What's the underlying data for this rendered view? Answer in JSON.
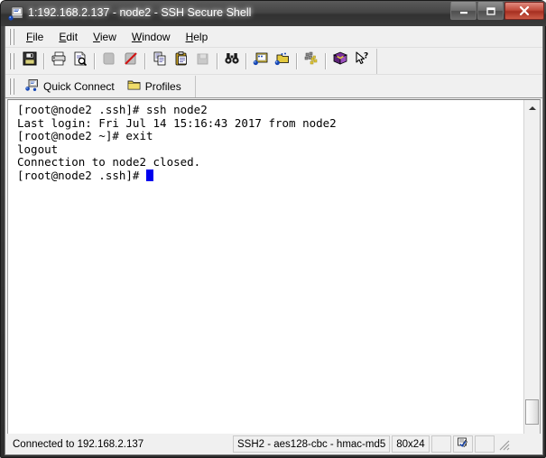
{
  "window": {
    "title": "1:192.168.2.137 - node2 - SSH Secure Shell",
    "app_icon": "ssh-terminal-icon",
    "buttons": {
      "minimize": "minimize-button",
      "maximize": "maximize-button",
      "close": "close-button"
    }
  },
  "menubar": {
    "items": [
      {
        "label": "File",
        "accel": "F"
      },
      {
        "label": "Edit",
        "accel": "E"
      },
      {
        "label": "View",
        "accel": "V"
      },
      {
        "label": "Window",
        "accel": "W"
      },
      {
        "label": "Help",
        "accel": "H"
      }
    ]
  },
  "toolbar": {
    "buttons": [
      {
        "name": "save-icon",
        "enabled": true
      },
      {
        "name": "print-icon",
        "enabled": true
      },
      {
        "name": "print-preview-icon",
        "enabled": true
      },
      {
        "name": "connect-icon",
        "enabled": false
      },
      {
        "name": "disconnect-icon",
        "enabled": true
      },
      {
        "name": "copy-icon",
        "enabled": true
      },
      {
        "name": "paste-icon",
        "enabled": true
      },
      {
        "name": "paste-clipboard-icon",
        "enabled": false
      },
      {
        "name": "find-icon",
        "enabled": true
      },
      {
        "name": "upload-transfer-icon",
        "enabled": true
      },
      {
        "name": "download-transfer-icon",
        "enabled": true
      },
      {
        "name": "settings-gear-icon",
        "enabled": true
      },
      {
        "name": "help-book-icon",
        "enabled": true
      },
      {
        "name": "context-help-icon",
        "enabled": true
      }
    ]
  },
  "quickbar": {
    "quick_connect_label": "Quick Connect",
    "quick_connect_icon": "quick-connect-icon",
    "profiles_label": "Profiles",
    "profiles_icon": "folder-icon"
  },
  "terminal": {
    "lines": [
      "[root@node2 .ssh]# ssh node2",
      "Last login: Fri Jul 14 15:16:43 2017 from node2",
      "[root@node2 ~]# exit",
      "logout",
      "Connection to node2 closed.",
      "[root@node2 .ssh]# "
    ],
    "cursor_color": "#0000ee",
    "background": "#ffffff",
    "foreground": "#000000"
  },
  "scrollbar": {
    "up_arrow": "scroll-up-icon",
    "down_arrow": "scroll-down-icon",
    "thumb": "scroll-thumb"
  },
  "statusbar": {
    "connection": "Connected to 192.168.2.137",
    "cipher": "SSH2 - aes128-cbc - hmac-md5",
    "dimensions": "80x24",
    "indicator_icon": "encryption-indicator-icon",
    "resize_grip": "resize-grip"
  }
}
